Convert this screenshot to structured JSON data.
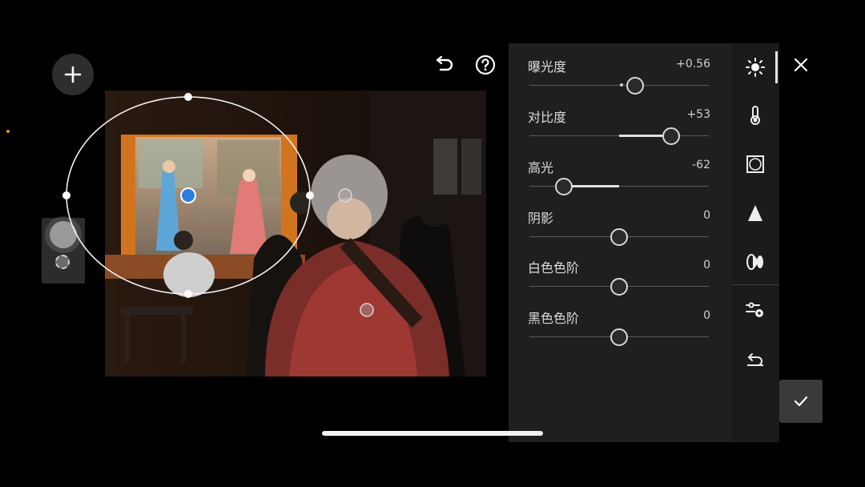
{
  "photo": {
    "description_icon": "photo-canvas"
  },
  "adjustments": [
    {
      "label": "曝光度",
      "value": "+0.56",
      "fraction": 0.59
    },
    {
      "label": "对比度",
      "value": "+53",
      "fraction": 0.79
    },
    {
      "label": "高光",
      "value": "-62",
      "fraction": 0.19
    },
    {
      "label": "阴影",
      "value": "0",
      "fraction": 0.5
    },
    {
      "label": "白色色阶",
      "value": "0",
      "fraction": 0.5
    },
    {
      "label": "黑色色阶",
      "value": "0",
      "fraction": 0.5
    }
  ],
  "tools": [
    "light-icon",
    "color-temp-icon",
    "vignette-icon",
    "sharpen-icon",
    "optics-icon",
    "adjust-reset-icon",
    "undo-icon"
  ],
  "colors": {
    "accent_blue": "#2f7fe0",
    "panel_bg": "#1f1f1f",
    "selection_orange": "#e39a2a"
  }
}
